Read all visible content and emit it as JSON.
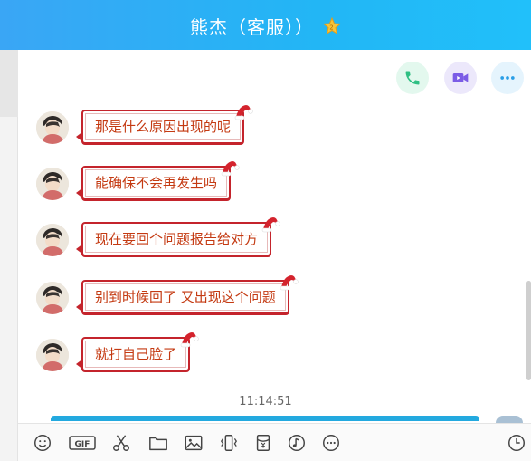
{
  "window": {
    "title": "熊杰（客服））"
  },
  "actions": [
    "phone-call",
    "video-call",
    "more-options"
  ],
  "messages": [
    {
      "text": "那是什么原因出现的呢"
    },
    {
      "text": "能确保不会再发生吗"
    },
    {
      "text": "现在要回个问题报告给对方"
    },
    {
      "text": "别到时候回了 又出现这个问题"
    },
    {
      "text": "就打自己脸了"
    }
  ],
  "timestamp": "11:14:51",
  "toolbar": {
    "gif_label": "GIF",
    "tools": [
      "emoji",
      "gif",
      "screenshot",
      "file",
      "image",
      "shake-window",
      "red-packet",
      "music",
      "more",
      "history"
    ]
  },
  "colors": {
    "titlebar_start": "#3aa6f5",
    "titlebar_end": "#21c0fa",
    "bubble_border": "#c4242c",
    "message_text": "#c43a12"
  }
}
